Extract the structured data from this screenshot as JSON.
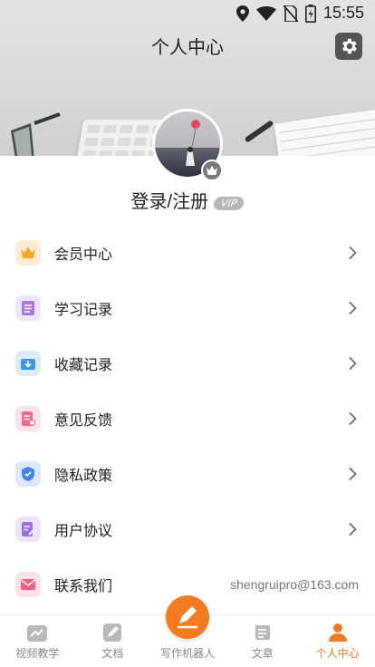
{
  "status_bar": {
    "time": "15:55",
    "icons": [
      "location-icon",
      "wifi-icon",
      "no-sim-icon",
      "battery-charging-icon"
    ]
  },
  "header": {
    "title": "个人中心",
    "settings_icon": "gear-icon"
  },
  "profile": {
    "login_label": "登录/注册",
    "vip_label": "VIP",
    "badge_icon": "crown-icon"
  },
  "menu": {
    "items": [
      {
        "label": "会员中心",
        "icon": "crown-icon",
        "color": "#f4a72a"
      },
      {
        "label": "学习记录",
        "icon": "list-doc-icon",
        "color": "#a57ae4"
      },
      {
        "label": "收藏记录",
        "icon": "download-box-icon",
        "color": "#3f97e8"
      },
      {
        "label": "意见反馈",
        "icon": "feedback-doc-icon",
        "color": "#f06a8a"
      },
      {
        "label": "隐私政策",
        "icon": "shield-icon",
        "color": "#3c86ee"
      },
      {
        "label": "用户协议",
        "icon": "agreement-doc-icon",
        "color": "#9a6fe0"
      },
      {
        "label": "联系我们",
        "icon": "mail-icon",
        "color": "#f36285"
      }
    ],
    "contact_email": "shengruipro@163.com"
  },
  "bottom_nav": {
    "items": [
      {
        "label": "视频教学",
        "icon": "video-chart-icon"
      },
      {
        "label": "文档",
        "icon": "document-edit-icon"
      },
      {
        "label": "写作机器人",
        "icon": "pen-icon"
      },
      {
        "label": "文章",
        "icon": "article-icon"
      },
      {
        "label": "个人中心",
        "icon": "person-icon",
        "active": true
      }
    ],
    "accent_color": "#f47b20"
  }
}
